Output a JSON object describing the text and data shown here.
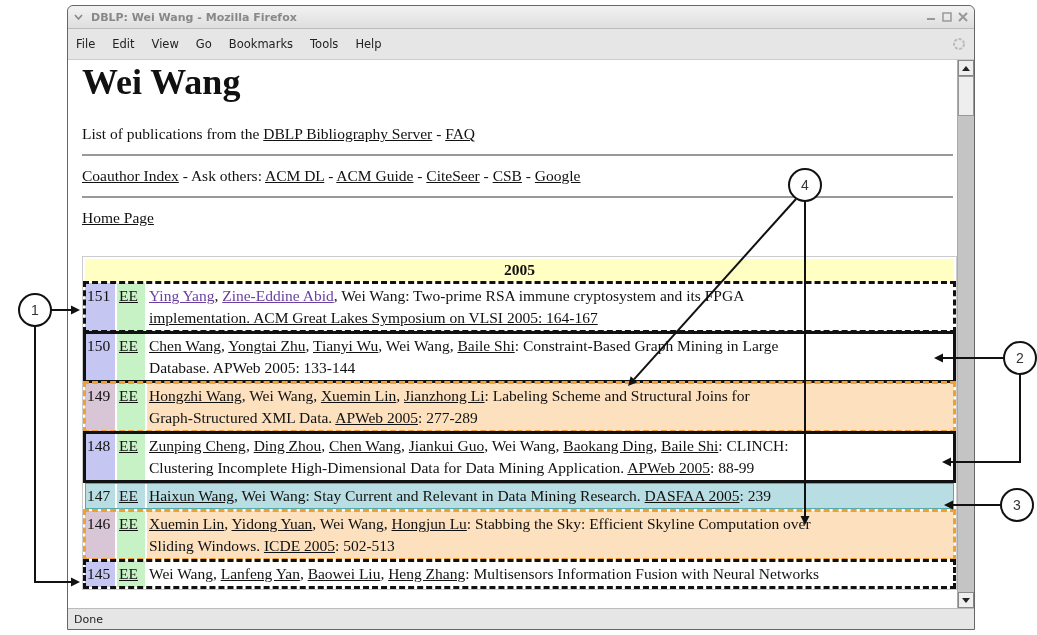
{
  "window": {
    "title": "DBLP: Wei Wang - Mozilla Firefox"
  },
  "menu": [
    "File",
    "Edit",
    "View",
    "Go",
    "Bookmarks",
    "Tools",
    "Help"
  ],
  "heading": "Wei Wang",
  "paragraphs": [
    [
      {
        "text": "List of publications from the ",
        "kind": "plain"
      },
      {
        "text": "DBLP Bibliography Server",
        "kind": "link"
      },
      {
        "text": " - ",
        "kind": "plain"
      },
      {
        "text": "FAQ",
        "kind": "link"
      }
    ],
    [
      {
        "text": "Coauthor Index",
        "kind": "link"
      },
      {
        "text": " - Ask others: ",
        "kind": "plain"
      },
      {
        "text": "ACM DL",
        "kind": "link"
      },
      {
        "text": " - ",
        "kind": "plain"
      },
      {
        "text": "ACM Guide",
        "kind": "link"
      },
      {
        "text": " - ",
        "kind": "plain"
      },
      {
        "text": "CiteSeer",
        "kind": "link"
      },
      {
        "text": " - ",
        "kind": "plain"
      },
      {
        "text": "CSB",
        "kind": "link"
      },
      {
        "text": " - ",
        "kind": "plain"
      },
      {
        "text": "Google",
        "kind": "link"
      }
    ],
    [
      {
        "text": "Home Page",
        "kind": "link"
      }
    ]
  ],
  "year": "2005",
  "publications": [
    {
      "number": "151",
      "ee": "EE",
      "kind": "dashed",
      "lines": [
        [
          {
            "text": "Ying Yang",
            "kind": "visited"
          },
          {
            "text": ", ",
            "kind": "plain"
          },
          {
            "text": "Zine-Eddine Abid",
            "kind": "visited"
          },
          {
            "text": ", Wei Wang: Two-prime RSA immune cryptosystem and its FPGA",
            "kind": "plain"
          }
        ],
        [
          {
            "text": "implementation. ACM Great Lakes Symposium on VLSI 2005: 164-167",
            "kind": "link"
          }
        ]
      ]
    },
    {
      "number": "150",
      "ee": "EE",
      "kind": "boxed",
      "lines": [
        [
          {
            "text": "Chen Wang",
            "kind": "link"
          },
          {
            "text": ", ",
            "kind": "plain"
          },
          {
            "text": "Yongtai Zhu",
            "kind": "link"
          },
          {
            "text": ", ",
            "kind": "plain"
          },
          {
            "text": "Tianyi Wu",
            "kind": "link"
          },
          {
            "text": ", Wei Wang, ",
            "kind": "plain"
          },
          {
            "text": "Baile Shi",
            "kind": "link"
          },
          {
            "text": ": Constraint-Based Graph Mining in Large",
            "kind": "plain"
          }
        ],
        [
          {
            "text": "Database. APWeb 2005: 133-144",
            "kind": "plain"
          }
        ]
      ]
    },
    {
      "number": "149",
      "ee": "EE",
      "kind": "orange",
      "lines": [
        [
          {
            "text": "Hongzhi Wang",
            "kind": "link"
          },
          {
            "text": ", Wei Wang, ",
            "kind": "plain"
          },
          {
            "text": "Xuemin Lin",
            "kind": "link"
          },
          {
            "text": ", ",
            "kind": "plain"
          },
          {
            "text": "Jianzhong Li",
            "kind": "link"
          },
          {
            "text": ": Labeling Scheme and Structural Joins for",
            "kind": "plain"
          }
        ],
        [
          {
            "text": "Graph-Structured XML Data. ",
            "kind": "plain"
          },
          {
            "text": "APWeb 2005",
            "kind": "link"
          },
          {
            "text": ": 277-289",
            "kind": "plain"
          }
        ]
      ]
    },
    {
      "number": "148",
      "ee": "EE",
      "kind": "boxed",
      "lines": [
        [
          {
            "text": "Zunping Cheng",
            "kind": "link"
          },
          {
            "text": ", ",
            "kind": "plain"
          },
          {
            "text": "Ding Zhou",
            "kind": "link"
          },
          {
            "text": ", ",
            "kind": "plain"
          },
          {
            "text": "Chen Wang",
            "kind": "link"
          },
          {
            "text": ", ",
            "kind": "plain"
          },
          {
            "text": "Jiankui Guo",
            "kind": "link"
          },
          {
            "text": ", Wei Wang, ",
            "kind": "plain"
          },
          {
            "text": "Baokang Ding",
            "kind": "link"
          },
          {
            "text": ", ",
            "kind": "plain"
          },
          {
            "text": "Baile Shi",
            "kind": "link"
          },
          {
            "text": ": CLINCH:",
            "kind": "plain"
          }
        ],
        [
          {
            "text": "Clustering Incomplete High-Dimensional Data for Data Mining Application. ",
            "kind": "plain"
          },
          {
            "text": "APWeb 2005",
            "kind": "link"
          },
          {
            "text": ": 88-99",
            "kind": "plain"
          }
        ]
      ]
    },
    {
      "number": "147",
      "ee": "EE",
      "kind": "teal",
      "lines": [
        [
          {
            "text": "Haixun Wang",
            "kind": "link"
          },
          {
            "text": ", Wei Wang: Stay Current and Relevant in Data Mining Research. ",
            "kind": "plain"
          },
          {
            "text": "DASFAA 2005",
            "kind": "link"
          },
          {
            "text": ": 239",
            "kind": "plain"
          }
        ]
      ]
    },
    {
      "number": "146",
      "ee": "EE",
      "kind": "orange",
      "lines": [
        [
          {
            "text": "Xuemin Lin",
            "kind": "link"
          },
          {
            "text": ", ",
            "kind": "plain"
          },
          {
            "text": "Yidong Yuan",
            "kind": "link"
          },
          {
            "text": ", Wei Wang, ",
            "kind": "plain"
          },
          {
            "text": "Hongjun Lu",
            "kind": "link"
          },
          {
            "text": ": Stabbing the Sky: Efficient Skyline Computation over",
            "kind": "plain"
          }
        ],
        [
          {
            "text": "Sliding Windows. ",
            "kind": "plain"
          },
          {
            "text": "ICDE 2005",
            "kind": "link"
          },
          {
            "text": ": 502-513",
            "kind": "plain"
          }
        ]
      ]
    },
    {
      "number": "145",
      "ee": "EE",
      "kind": "dashed",
      "lines": [
        [
          {
            "text": "Wei Wang, ",
            "kind": "plain"
          },
          {
            "text": "Lanfeng Yan",
            "kind": "link"
          },
          {
            "text": ", ",
            "kind": "plain"
          },
          {
            "text": "Baowei Liu",
            "kind": "link"
          },
          {
            "text": ", ",
            "kind": "plain"
          },
          {
            "text": "Heng Zhang",
            "kind": "link"
          },
          {
            "text": ": Multisensors Information Fusion with Neural Networks",
            "kind": "plain"
          }
        ]
      ]
    }
  ],
  "status_bar": "Done",
  "callouts": [
    {
      "label": "1"
    },
    {
      "label": "2"
    },
    {
      "label": "3"
    },
    {
      "label": "4"
    }
  ]
}
